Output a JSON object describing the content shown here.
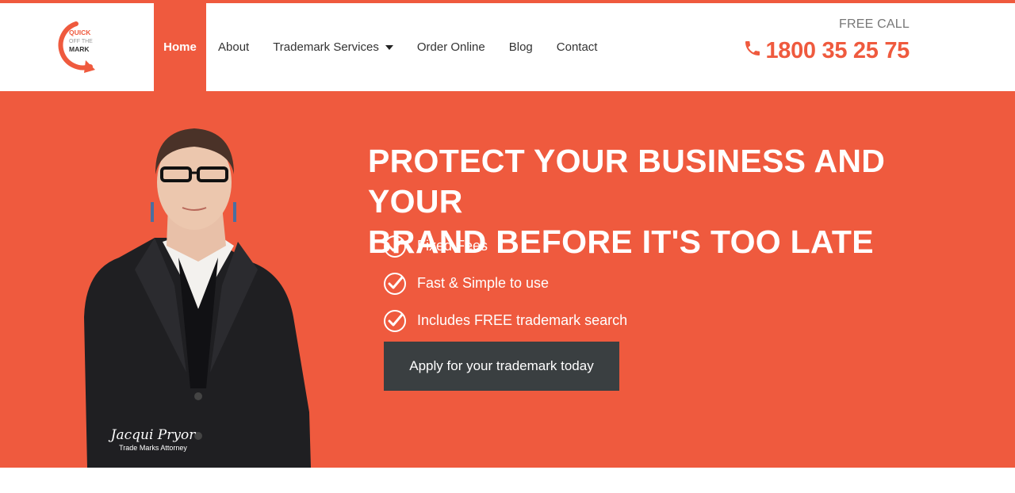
{
  "brand": {
    "logo_line1": "QUICK",
    "logo_line2": "OFF THE",
    "logo_line3": "MARK",
    "accent_color": "#ef5a3e",
    "dark_color": "#3a3f41"
  },
  "nav": {
    "items": [
      {
        "label": "Home",
        "active": true
      },
      {
        "label": "About"
      },
      {
        "label": "Trademark Services",
        "has_dropdown": true
      },
      {
        "label": "Order Online"
      },
      {
        "label": "Blog"
      },
      {
        "label": "Contact"
      }
    ]
  },
  "call": {
    "label": "FREE CALL",
    "number": "1800 35 25 75",
    "icon": "phone-icon"
  },
  "hero": {
    "headline_line1": "PROTECT YOUR BUSINESS AND YOUR",
    "headline_line2": "BRAND BEFORE IT'S TOO LATE",
    "features": [
      {
        "text": "Fixed Fees",
        "icon": "check-circle-icon"
      },
      {
        "text": "Fast & Simple to use",
        "icon": "check-circle-icon"
      },
      {
        "text": "Includes FREE trademark search",
        "icon": "check-circle-icon"
      }
    ],
    "cta_label": "Apply for your trademark today",
    "signature_name": "Jacqui Pryor",
    "signature_title": "Trade Marks Attorney"
  }
}
